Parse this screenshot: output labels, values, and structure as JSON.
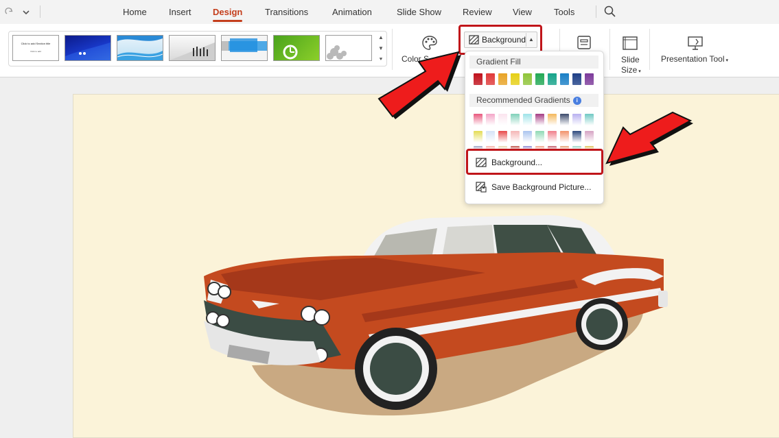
{
  "menubar": {
    "tabs": [
      {
        "label": "Home"
      },
      {
        "label": "Insert"
      },
      {
        "label": "Design"
      },
      {
        "label": "Transitions"
      },
      {
        "label": "Animation"
      },
      {
        "label": "Slide Show"
      },
      {
        "label": "Review"
      },
      {
        "label": "View"
      },
      {
        "label": "Tools"
      }
    ],
    "active_tab": "Design",
    "icons": [
      "redo-icon",
      "chevron-down-icon",
      "search-icon"
    ]
  },
  "ribbon": {
    "theme_thumbnail_text": {
      "title": "Click to add Section title",
      "subtitle": "Click to add"
    },
    "color_scheme_label": "Color S",
    "background_button_label": "Background",
    "slide_size_label_1": "Slide",
    "slide_size_label_2": "Size",
    "presentation_tool_label": "Presentation Tool"
  },
  "dropdown": {
    "gradient_fill_title": "Gradient Fill",
    "gradient_fill_colors": [
      "#c0111c",
      "#e03a3a",
      "#e8a326",
      "#e6cf16",
      "#8fc43a",
      "#22a855",
      "#16a38a",
      "#1a7fc6",
      "#1e3f86",
      "#7c3a9a"
    ],
    "recommended_title": "Recommended Gradients",
    "recommended_rows": [
      [
        "#e8577d",
        "#f4a6c8",
        "#fbe4ee",
        "#7fd1b9",
        "#9ee3e8",
        "#a53c84",
        "#f4b85b",
        "#3b4a6b",
        "#b8b0f0",
        "#6fc9c4"
      ],
      [
        "#e4dc54",
        "#d6e3f7",
        "#e84a4a",
        "#f5b6b6",
        "#a9c4ef",
        "#8fd9b4",
        "#f07f8b",
        "#f2926a",
        "#2e4a7e",
        "#d6a3c4"
      ],
      [
        "#9ea6c4",
        "#f6b4a9",
        "#e8d6b0",
        "#c0524a",
        "#8f8ad2",
        "#f2a48c",
        "#c45d6b",
        "#e6a074",
        "#9ed6c8",
        "#e0c25c"
      ]
    ],
    "items": [
      {
        "label": "Background..."
      },
      {
        "label": "Save Background Picture..."
      }
    ]
  },
  "colors": {
    "accent": "#c43e1c",
    "highlight": "#c0151a",
    "slide_background": "#fbf3d9"
  }
}
